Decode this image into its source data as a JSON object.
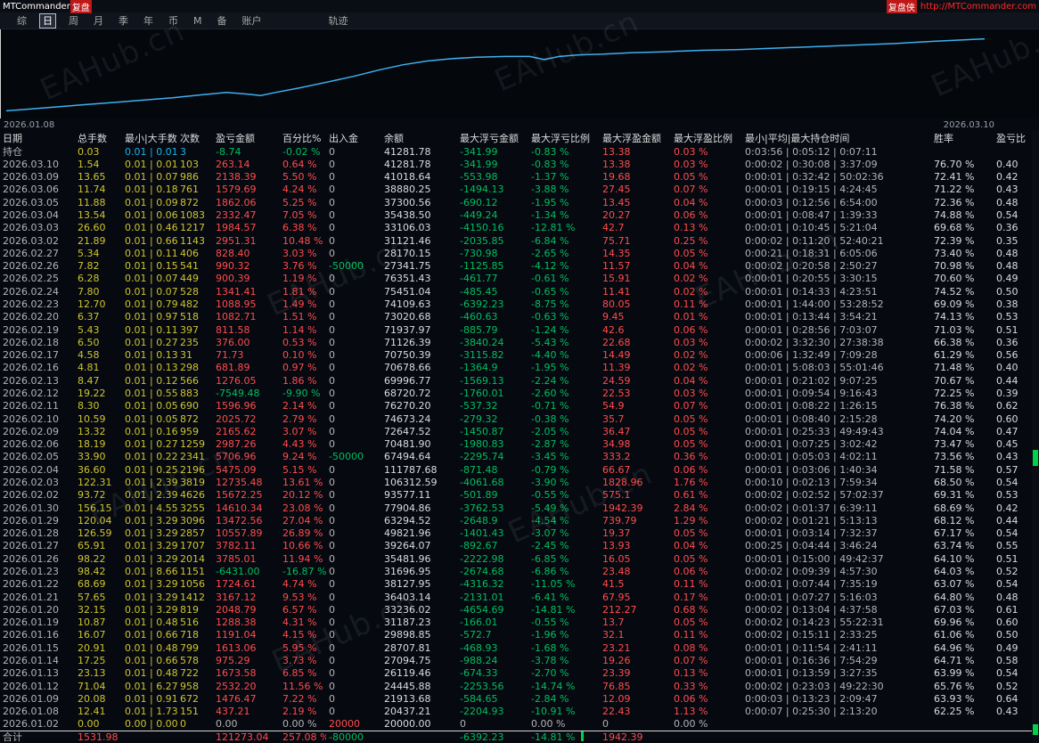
{
  "titlebar": {
    "app_name": "MTCommander",
    "app_suffix": "复盘",
    "right_badge": "复盘侠",
    "right_url": "http://MTCommander.com"
  },
  "menu": {
    "items": [
      "综",
      "日",
      "周",
      "月",
      "季",
      "年",
      "币",
      "M",
      "备",
      "账户",
      "轨迹"
    ],
    "selected": "日"
  },
  "watermark": {
    "text": "EAHub.cn"
  },
  "chart": {
    "start_date": "2026.01.08",
    "end_date": "2026.03.10"
  },
  "chart_data": {
    "type": "line",
    "title": "",
    "xlabel": "",
    "ylabel": "",
    "x_start_label": "2026.01.08",
    "x_end_label": "2026.03.10",
    "legend": [],
    "grid": false,
    "series": [
      {
        "name": "equity-curve",
        "color": "#3fb0f0",
        "x": [
          0,
          0.02,
          0.05,
          0.08,
          0.11,
          0.14,
          0.17,
          0.2,
          0.225,
          0.245,
          0.26,
          0.275,
          0.3,
          0.33,
          0.355,
          0.38,
          0.405,
          0.43,
          0.455,
          0.48,
          0.51,
          0.535,
          0.55,
          0.565,
          0.585,
          0.61,
          0.64,
          0.67,
          0.71,
          0.75,
          0.79,
          0.83,
          0.87,
          0.91,
          0.95,
          1.0
        ],
        "y": [
          3,
          5,
          8,
          11,
          14,
          17,
          20,
          24,
          27,
          25,
          23,
          27,
          33,
          41,
          48,
          56,
          63,
          68,
          71,
          73,
          74,
          74,
          70,
          74,
          76,
          77,
          79,
          80,
          82,
          83,
          85,
          87,
          89,
          91,
          94,
          97
        ]
      }
    ],
    "ylim": [
      0,
      100
    ]
  },
  "table": {
    "headers": [
      "日期",
      "总手数",
      "最小|大手数",
      "次数",
      "盈亏金额",
      "百分比%",
      "出入金",
      "余额",
      "最大浮亏金额",
      "最大浮亏比例",
      "最大浮盈金额",
      "最大浮盈比例",
      "最小|平均|最大持仓时间",
      "胜率",
      "盈亏比"
    ],
    "rows": [
      [
        "持仓",
        "0.03",
        "0.01 | 0.01",
        "3",
        "-8.74",
        "-0.02 %",
        "0",
        "41281.78",
        "-341.99",
        "-0.83 %",
        "13.38",
        "0.03 %",
        "0:03:56 | 0:05:12 | 0:07:11",
        "",
        ""
      ],
      [
        "2026.03.10",
        "1.54",
        "0.01 | 0.01",
        "103",
        "263.14",
        "0.64 %",
        "0",
        "41281.78",
        "-341.99",
        "-0.83 %",
        "13.38",
        "0.03 %",
        "0:00:02 | 0:30:08 | 3:37:09",
        "76.70 %",
        "0.40"
      ],
      [
        "2026.03.09",
        "13.65",
        "0.01 | 0.07",
        "986",
        "2138.39",
        "5.50 %",
        "0",
        "41018.64",
        "-553.98",
        "-1.37 %",
        "19.68",
        "0.05 %",
        "0:00:01 | 0:32:42 | 50:02:36",
        "72.41 %",
        "0.42"
      ],
      [
        "2026.03.06",
        "11.74",
        "0.01 | 0.18",
        "761",
        "1579.69",
        "4.24 %",
        "0",
        "38880.25",
        "-1494.13",
        "-3.88 %",
        "27.45",
        "0.07 %",
        "0:00:01 | 0:19:15 | 4:24:45",
        "71.22 %",
        "0.43"
      ],
      [
        "2026.03.05",
        "11.88",
        "0.01 | 0.09",
        "872",
        "1862.06",
        "5.25 %",
        "0",
        "37300.56",
        "-690.12",
        "-1.95 %",
        "13.45",
        "0.04 %",
        "0:00:03 | 0:12:56 | 6:54:00",
        "72.36 %",
        "0.48"
      ],
      [
        "2026.03.04",
        "13.54",
        "0.01 | 0.06",
        "1083",
        "2332.47",
        "7.05 %",
        "0",
        "35438.50",
        "-449.24",
        "-1.34 %",
        "20.27",
        "0.06 %",
        "0:00:01 | 0:08:47 | 1:39:33",
        "74.88 %",
        "0.54"
      ],
      [
        "2026.03.03",
        "26.60",
        "0.01 | 0.46",
        "1217",
        "1984.57",
        "6.38 %",
        "0",
        "33106.03",
        "-4150.16",
        "-12.81 %",
        "42.7",
        "0.13 %",
        "0:00:01 | 0:10:45 | 5:21:04",
        "69.68 %",
        "0.36"
      ],
      [
        "2026.03.02",
        "21.89",
        "0.01 | 0.66",
        "1143",
        "2951.31",
        "10.48 %",
        "0",
        "31121.46",
        "-2035.85",
        "-6.84 %",
        "75.71",
        "0.25 %",
        "0:00:02 | 0:11:20 | 52:40:21",
        "72.39 %",
        "0.35"
      ],
      [
        "2026.02.27",
        "5.34",
        "0.01 | 0.11",
        "406",
        "828.40",
        "3.03 %",
        "0",
        "28170.15",
        "-730.98",
        "-2.65 %",
        "14.35",
        "0.05 %",
        "0:00:21 | 0:18:31 | 6:05:06",
        "73.40 %",
        "0.48"
      ],
      [
        "2026.02.26",
        "7.82",
        "0.01 | 0.15",
        "541",
        "990.32",
        "3.76 %",
        "-50000",
        "27341.75",
        "-1125.85",
        "-4.12 %",
        "11.57",
        "0.04 %",
        "0:00:02 | 0:20:58 | 2:50:27",
        "70.98 %",
        "0.48"
      ],
      [
        "2026.02.25",
        "6.28",
        "0.01 | 0.07",
        "449",
        "900.39",
        "1.19 %",
        "0",
        "76351.43",
        "-461.77",
        "-0.61 %",
        "15.91",
        "0.02 %",
        "0:00:01 | 0:20:55 | 3:30:15",
        "70.60 %",
        "0.49"
      ],
      [
        "2026.02.24",
        "7.80",
        "0.01 | 0.07",
        "528",
        "1341.41",
        "1.81 %",
        "0",
        "75451.04",
        "-485.45",
        "-0.65 %",
        "11.41",
        "0.02 %",
        "0:00:01 | 0:14:33 | 4:23:51",
        "74.52 %",
        "0.50"
      ],
      [
        "2026.02.23",
        "12.70",
        "0.01 | 0.79",
        "482",
        "1088.95",
        "1.49 %",
        "0",
        "74109.63",
        "-6392.23",
        "-8.75 %",
        "80.05",
        "0.11 %",
        "0:00:01 | 1:44:00 | 53:28:52",
        "69.09 %",
        "0.38"
      ],
      [
        "2026.02.20",
        "6.37",
        "0.01 | 0.97",
        "518",
        "1082.71",
        "1.51 %",
        "0",
        "73020.68",
        "-460.63",
        "-0.63 %",
        "9.45",
        "0.01 %",
        "0:00:01 | 0:13:44 | 3:54:21",
        "74.13 %",
        "0.53"
      ],
      [
        "2026.02.19",
        "5.43",
        "0.01 | 0.11",
        "397",
        "811.58",
        "1.14 %",
        "0",
        "71937.97",
        "-885.79",
        "-1.24 %",
        "42.6",
        "0.06 %",
        "0:00:01 | 0:28:56 | 7:03:07",
        "71.03 %",
        "0.51"
      ],
      [
        "2026.02.18",
        "6.50",
        "0.01 | 0.27",
        "235",
        "376.00",
        "0.53 %",
        "0",
        "71126.39",
        "-3840.24",
        "-5.43 %",
        "22.68",
        "0.03 %",
        "0:00:02 | 3:32:30 | 27:38:38",
        "66.38 %",
        "0.36"
      ],
      [
        "2026.02.17",
        "4.58",
        "0.01 | 0.13",
        "31",
        "71.73",
        "0.10 %",
        "0",
        "70750.39",
        "-3115.82",
        "-4.40 %",
        "14.49",
        "0.02 %",
        "0:00:06 | 1:32:49 | 7:09:28",
        "61.29 %",
        "0.56"
      ],
      [
        "2026.02.16",
        "4.81",
        "0.01 | 0.13",
        "298",
        "681.89",
        "0.97 %",
        "0",
        "70678.66",
        "-1364.9",
        "-1.95 %",
        "11.39",
        "0.02 %",
        "0:00:01 | 5:08:03 | 55:01:46",
        "71.48 %",
        "0.40"
      ],
      [
        "2026.02.13",
        "8.47",
        "0.01 | 0.12",
        "566",
        "1276.05",
        "1.86 %",
        "0",
        "69996.77",
        "-1569.13",
        "-2.24 %",
        "24.59",
        "0.04 %",
        "0:00:01 | 0:21:02 | 9:07:25",
        "70.67 %",
        "0.44"
      ],
      [
        "2026.02.12",
        "19.22",
        "0.01 | 0.55",
        "883",
        "-7549.48",
        "-9.90 %",
        "0",
        "68720.72",
        "-1760.01",
        "-2.60 %",
        "22.53",
        "0.03 %",
        "0:00:01 | 0:09:54 | 9:16:43",
        "72.25 %",
        "0.39"
      ],
      [
        "2026.02.11",
        "8.30",
        "0.01 | 0.05",
        "690",
        "1596.96",
        "2.14 %",
        "0",
        "76270.20",
        "-537.32",
        "-0.71 %",
        "54.9",
        "0.07 %",
        "0:00:01 | 0:08:22 | 1:26:15",
        "76.38 %",
        "0.62"
      ],
      [
        "2026.02.10",
        "10.59",
        "0.01 | 0.05",
        "872",
        "2025.72",
        "2.79 %",
        "0",
        "74673.24",
        "-279.32",
        "-0.38 %",
        "35.7",
        "0.05 %",
        "0:00:01 | 0:08:40 | 2:15:28",
        "74.20 %",
        "0.60"
      ],
      [
        "2026.02.09",
        "13.32",
        "0.01 | 0.16",
        "959",
        "2165.62",
        "3.07 %",
        "0",
        "72647.52",
        "-1450.87",
        "-2.05 %",
        "36.47",
        "0.05 %",
        "0:00:01 | 0:25:33 | 49:49:43",
        "74.04 %",
        "0.47"
      ],
      [
        "2026.02.06",
        "18.19",
        "0.01 | 0.27",
        "1259",
        "2987.26",
        "4.43 %",
        "0",
        "70481.90",
        "-1980.83",
        "-2.87 %",
        "34.98",
        "0.05 %",
        "0:00:01 | 0:07:25 | 3:02:42",
        "73.47 %",
        "0.45"
      ],
      [
        "2026.02.05",
        "33.90",
        "0.01 | 0.22",
        "2341",
        "5706.96",
        "9.24 %",
        "-50000",
        "67494.64",
        "-2295.74",
        "-3.45 %",
        "333.2",
        "0.36 %",
        "0:00:01 | 0:05:03 | 4:02:11",
        "73.56 %",
        "0.43"
      ],
      [
        "2026.02.04",
        "36.60",
        "0.01 | 0.25",
        "2196",
        "5475.09",
        "5.15 %",
        "0",
        "111787.68",
        "-871.48",
        "-0.79 %",
        "66.67",
        "0.06 %",
        "0:00:01 | 0:03:06 | 1:40:34",
        "71.58 %",
        "0.57"
      ],
      [
        "2026.02.03",
        "122.31",
        "0.01 | 2.39",
        "3819",
        "12735.48",
        "13.61 %",
        "0",
        "106312.59",
        "-4061.68",
        "-3.90 %",
        "1828.96",
        "1.76 %",
        "0:00:10 | 0:02:13 | 7:59:34",
        "68.50 %",
        "0.54"
      ],
      [
        "2026.02.02",
        "93.72",
        "0.01 | 2.39",
        "4626",
        "15672.25",
        "20.12 %",
        "0",
        "93577.11",
        "-501.89",
        "-0.55 %",
        "575.1",
        "0.61 %",
        "0:00:02 | 0:02:52 | 57:02:37",
        "69.31 %",
        "0.53"
      ],
      [
        "2026.01.30",
        "156.15",
        "0.01 | 4.55",
        "3255",
        "14610.34",
        "23.08 %",
        "0",
        "77904.86",
        "-3762.53",
        "-5.49 %",
        "1942.39",
        "2.84 %",
        "0:00:02 | 0:01:37 | 6:39:11",
        "68.69 %",
        "0.42"
      ],
      [
        "2026.01.29",
        "120.04",
        "0.01 | 3.29",
        "3096",
        "13472.56",
        "27.04 %",
        "0",
        "63294.52",
        "-2648.9",
        "-4.54 %",
        "739.79",
        "1.29 %",
        "0:00:02 | 0:01:21 | 5:13:13",
        "68.12 %",
        "0.44"
      ],
      [
        "2026.01.28",
        "126.59",
        "0.01 | 3.29",
        "2857",
        "10557.89",
        "26.89 %",
        "0",
        "49821.96",
        "-1401.43",
        "-3.07 %",
        "19.37",
        "0.05 %",
        "0:00:01 | 0:03:14 | 7:32:37",
        "67.17 %",
        "0.54"
      ],
      [
        "2026.01.27",
        "65.91",
        "0.01 | 3.29",
        "1707",
        "3782.11",
        "10.66 %",
        "0",
        "39264.07",
        "-892.67",
        "-2.45 %",
        "13.93",
        "0.04 %",
        "0:00:25 | 0:04:44 | 3:46:24",
        "63.74 %",
        "0.55"
      ],
      [
        "2026.01.26",
        "98.22",
        "0.01 | 3.29",
        "2014",
        "3785.01",
        "11.94 %",
        "0",
        "35481.96",
        "-2222.98",
        "-6.85 %",
        "16.05",
        "0.05 %",
        "0:00:01 | 0:15:00 | 49:42:37",
        "64.10 %",
        "0.51"
      ],
      [
        "2026.01.23",
        "98.42",
        "0.01 | 8.66",
        "1151",
        "-6431.00",
        "-16.87 %",
        "0",
        "31696.95",
        "-2674.68",
        "-6.86 %",
        "23.48",
        "0.06 %",
        "0:00:02 | 0:09:39 | 4:57:30",
        "64.03 %",
        "0.52"
      ],
      [
        "2026.01.22",
        "68.69",
        "0.01 | 3.29",
        "1056",
        "1724.61",
        "4.74 %",
        "0",
        "38127.95",
        "-4316.32",
        "-11.05 %",
        "41.5",
        "0.11 %",
        "0:00:01 | 0:07:44 | 7:35:19",
        "63.07 %",
        "0.54"
      ],
      [
        "2026.01.21",
        "57.65",
        "0.01 | 3.29",
        "1412",
        "3167.12",
        "9.53 %",
        "0",
        "36403.14",
        "-2131.01",
        "-6.41 %",
        "67.95",
        "0.17 %",
        "0:00:01 | 0:07:27 | 5:16:03",
        "64.80 %",
        "0.48"
      ],
      [
        "2026.01.20",
        "32.15",
        "0.01 | 3.29",
        "819",
        "2048.79",
        "6.57 %",
        "0",
        "33236.02",
        "-4654.69",
        "-14.81 %",
        "212.27",
        "0.68 %",
        "0:00:02 | 0:13:04 | 4:37:58",
        "67.03 %",
        "0.61"
      ],
      [
        "2026.01.19",
        "10.87",
        "0.01 | 0.48",
        "516",
        "1288.38",
        "4.31 %",
        "0",
        "31187.23",
        "-166.01",
        "-0.55 %",
        "13.7",
        "0.05 %",
        "0:00:02 | 0:14:23 | 55:22:31",
        "69.96 %",
        "0.60"
      ],
      [
        "2026.01.16",
        "16.07",
        "0.01 | 0.66",
        "718",
        "1191.04",
        "4.15 %",
        "0",
        "29898.85",
        "-572.7",
        "-1.96 %",
        "32.1",
        "0.11 %",
        "0:00:02 | 0:15:11 | 2:33:25",
        "61.06 %",
        "0.50"
      ],
      [
        "2026.01.15",
        "20.91",
        "0.01 | 0.48",
        "799",
        "1613.06",
        "5.95 %",
        "0",
        "28707.81",
        "-468.93",
        "-1.68 %",
        "23.21",
        "0.08 %",
        "0:00:01 | 0:11:54 | 2:41:11",
        "64.96 %",
        "0.49"
      ],
      [
        "2026.01.14",
        "17.25",
        "0.01 | 0.66",
        "578",
        "975.29",
        "3.73 %",
        "0",
        "27094.75",
        "-988.24",
        "-3.78 %",
        "19.26",
        "0.07 %",
        "0:00:01 | 0:16:36 | 7:54:29",
        "64.71 %",
        "0.58"
      ],
      [
        "2026.01.13",
        "23.13",
        "0.01 | 0.48",
        "722",
        "1673.58",
        "6.85 %",
        "0",
        "26119.46",
        "-674.33",
        "-2.70 %",
        "23.39",
        "0.13 %",
        "0:00:01 | 0:13:59 | 3:27:35",
        "63.99 %",
        "0.54"
      ],
      [
        "2026.01.12",
        "71.04",
        "0.01 | 6.27",
        "958",
        "2532.20",
        "11.56 %",
        "0",
        "24445.88",
        "-2253.56",
        "-14.74 %",
        "76.85",
        "0.33 %",
        "0:00:02 | 0:23:03 | 49:22:30",
        "65.76 %",
        "0.52"
      ],
      [
        "2026.01.09",
        "20.08",
        "0.01 | 0.91",
        "672",
        "1476.47",
        "7.22 %",
        "0",
        "21913.68",
        "-584.65",
        "-2.84 %",
        "12.09",
        "0.06 %",
        "0:00:03 | 0:13:23 | 2:09:47",
        "63.93 %",
        "0.64"
      ],
      [
        "2026.01.08",
        "12.41",
        "0.01 | 1.73",
        "151",
        "437.21",
        "2.19 %",
        "0",
        "20437.21",
        "-2204.93",
        "-10.91 %",
        "22.43",
        "1.13 %",
        "0:00:07 | 0:25:30 | 2:13:20",
        "62.25 %",
        "0.43"
      ],
      [
        "2026.01.02",
        "0.00",
        "0.00 | 0.00",
        "0",
        "0.00",
        "0.00 %",
        "20000",
        "20000.00",
        "0",
        "0.00 %",
        "0",
        "0.00 %",
        "",
        "",
        ""
      ]
    ],
    "total_row": [
      "合计",
      "1531.98",
      "",
      "",
      "121273.04",
      "257.08 %",
      "-80000",
      "",
      "-6392.23",
      "-14.81 %",
      "1942.39",
      "",
      "",
      "",
      ""
    ]
  }
}
